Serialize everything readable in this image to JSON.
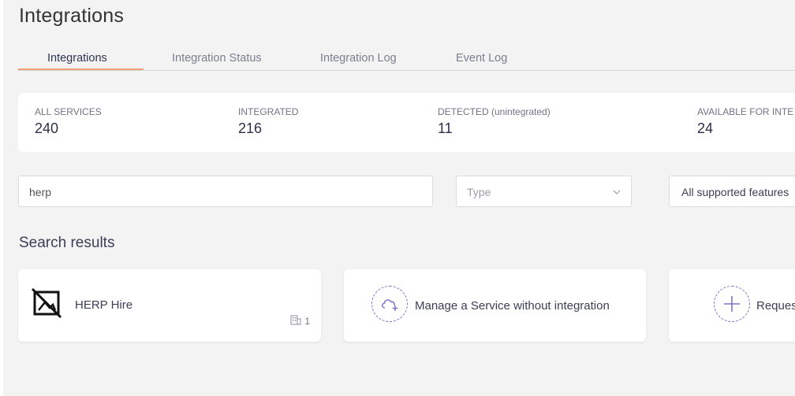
{
  "header": {
    "title": "Integrations"
  },
  "tabs": [
    {
      "label": "Integrations",
      "active": true
    },
    {
      "label": "Integration Status",
      "active": false
    },
    {
      "label": "Integration Log",
      "active": false
    },
    {
      "label": "Event Log",
      "active": false
    }
  ],
  "stats": [
    {
      "label": "ALL SERVICES",
      "value": "240"
    },
    {
      "label": "INTEGRATED",
      "value": "216"
    },
    {
      "label": "DETECTED (unintegrated)",
      "value": "11"
    },
    {
      "label": "AVAILABLE FOR INTE",
      "value": "24"
    }
  ],
  "filters": {
    "search_value": "herp",
    "type_placeholder": "Type",
    "features_value": "All supported features"
  },
  "results": {
    "title": "Search results",
    "service": {
      "name": "HERP Hire",
      "count": "1",
      "icon": "no-image-icon"
    },
    "manage_label": "Manage a Service without integration",
    "request_label": "Reques"
  },
  "colors": {
    "accent": "#f0a070",
    "purple": "#7b75c9"
  }
}
